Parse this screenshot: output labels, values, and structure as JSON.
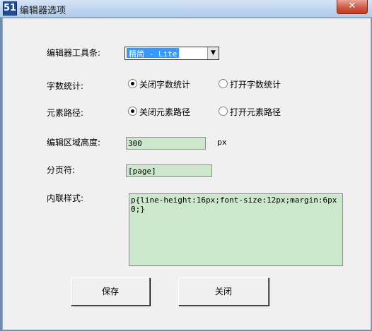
{
  "window": {
    "title": "编辑器选项",
    "icon_text": "51",
    "close_symbol": "✕"
  },
  "form": {
    "toolbar_label": "编辑器工具条:",
    "toolbar_value": "精简 - Lite",
    "wordcount_label": "字数统计:",
    "wordcount_off": "关闭字数统计",
    "wordcount_on": "打开字数统计",
    "elementpath_label": "元素路径:",
    "elementpath_off": "关闭元素路径",
    "elementpath_on": "打开元素路径",
    "height_label": "编辑区域高度:",
    "height_value": "300",
    "height_unit": "px",
    "pagebreak_label": "分页符:",
    "pagebreak_value": "[page]",
    "style_label": "内联样式:",
    "style_value": "p{line-height:16px;font-size:12px;margin:6px 0;}"
  },
  "buttons": {
    "save": "保存",
    "close": "关闭"
  },
  "state": {
    "wordcount_selected": "off",
    "elementpath_selected": "off"
  }
}
